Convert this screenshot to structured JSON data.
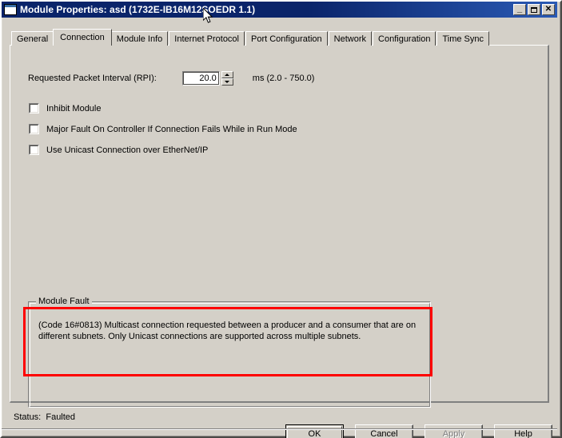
{
  "window": {
    "title": "Module Properties: asd (1732E-IB16M12SOEDR 1.1)",
    "icon": "window-icon",
    "minimize_label": "_",
    "maximize_label": "maximize-icon",
    "close_label": "✕"
  },
  "tabs": [
    {
      "label": "General",
      "active": false
    },
    {
      "label": "Connection",
      "active": true
    },
    {
      "label": "Module Info",
      "active": false
    },
    {
      "label": "Internet Protocol",
      "active": false
    },
    {
      "label": "Port Configuration",
      "active": false
    },
    {
      "label": "Network",
      "active": false
    },
    {
      "label": "Configuration",
      "active": false
    },
    {
      "label": "Time Sync",
      "active": false
    }
  ],
  "connection": {
    "rpi": {
      "label": "Requested Packet Interval (RPI):",
      "value": "20.0",
      "units": "ms (2.0 - 750.0)"
    },
    "checkboxes": [
      {
        "label": "Inhibit Module",
        "checked": false
      },
      {
        "label": "Major Fault On Controller If Connection Fails While in Run Mode",
        "checked": false
      },
      {
        "label": "Use Unicast Connection over EtherNet/IP",
        "checked": false
      }
    ],
    "module_fault": {
      "title": "Module Fault",
      "text": "(Code 16#0813) Multicast connection requested between a producer and a consumer that are on different subnets.  Only Unicast connections are supported across multiple subnets."
    }
  },
  "annotation": {
    "color": "#ff0000"
  },
  "status": {
    "text": "Status:  Faulted"
  },
  "buttons": [
    {
      "label": "OK",
      "state": "default"
    },
    {
      "label": "Cancel",
      "state": "normal"
    },
    {
      "label": "Apply",
      "state": "disabled"
    },
    {
      "label": "Help",
      "state": "normal"
    }
  ],
  "colors": {
    "dialog_face": "#d4d0c8",
    "title_active": "#0a246a",
    "annotation_red": "#ff0000",
    "field_white": "#ffffff"
  }
}
